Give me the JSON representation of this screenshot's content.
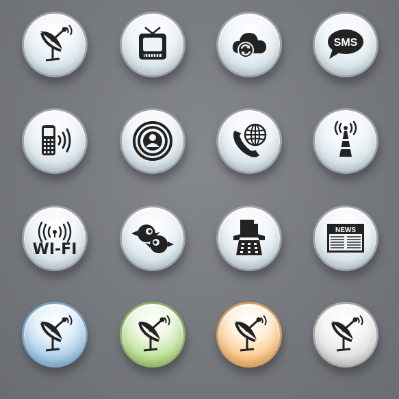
{
  "icons": {
    "sms_label": "SMS",
    "wifi_label": "WI-FI",
    "news_label": "NEWS"
  },
  "buttons": [
    {
      "name": "satellite-dish",
      "color": "default"
    },
    {
      "name": "tv",
      "color": "default"
    },
    {
      "name": "cloud-sync",
      "color": "default"
    },
    {
      "name": "sms",
      "color": "default"
    },
    {
      "name": "mobile-phone-signal",
      "color": "default"
    },
    {
      "name": "user-broadcast",
      "color": "default"
    },
    {
      "name": "global-phone",
      "color": "default"
    },
    {
      "name": "antenna-tower",
      "color": "default"
    },
    {
      "name": "wifi",
      "color": "default"
    },
    {
      "name": "birds-chat",
      "color": "default"
    },
    {
      "name": "fax",
      "color": "default"
    },
    {
      "name": "newspaper",
      "color": "default"
    },
    {
      "name": "satellite-dish",
      "color": "blue"
    },
    {
      "name": "satellite-dish",
      "color": "green"
    },
    {
      "name": "satellite-dish",
      "color": "orange"
    },
    {
      "name": "satellite-dish",
      "color": "gray"
    }
  ],
  "colors": {
    "background": "#7a7d82",
    "icon": "#222222",
    "blue": "#6fa6d2",
    "green": "#86c452",
    "orange": "#f0a140",
    "gray": "#c2c2c2"
  }
}
